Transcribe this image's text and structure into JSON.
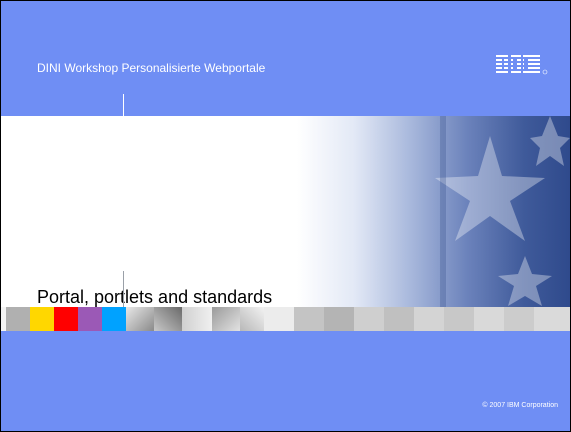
{
  "header": {
    "workshop_title": "DINI Workshop Personalisierte Webportale",
    "logo_text": "IBM"
  },
  "main": {
    "title": "Portal, portlets and standards"
  },
  "footer": {
    "copyright": "© 2007 IBM Corporation"
  },
  "colors": {
    "background": "#6f8ef4",
    "text_light": "#ffffff",
    "title": "#000000"
  },
  "strip_colors": [
    "#ffd700",
    "#ff0000",
    "#9b59b6",
    "#00a2ff"
  ]
}
